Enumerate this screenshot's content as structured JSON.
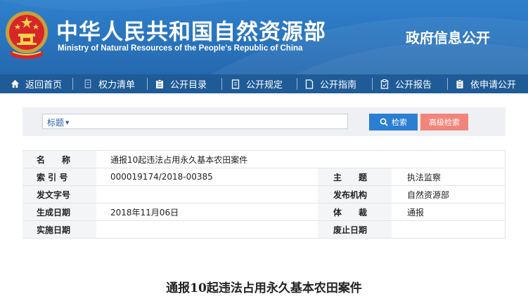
{
  "header": {
    "title_cn": "中华人民共和国自然资源部",
    "title_en": "Ministry of Natural Resources of the People's Republic of China",
    "section": "政府信息公开",
    "emblem_icon": "national-emblem-icon",
    "colors": {
      "header_blue": "#2f80cc",
      "nav_blue": "#1f5b97"
    }
  },
  "nav": {
    "items": [
      {
        "label": "返回首页",
        "icon": "home-icon"
      },
      {
        "label": "权力清单",
        "icon": "list-icon"
      },
      {
        "label": "公开目录",
        "icon": "clipboard-icon"
      },
      {
        "label": "公开规定",
        "icon": "document-icon"
      },
      {
        "label": "公开指南",
        "icon": "page-icon"
      },
      {
        "label": "公开报告",
        "icon": "report-icon"
      },
      {
        "label": "依申请公开",
        "icon": "request-icon"
      }
    ]
  },
  "search": {
    "type_label": "标题",
    "value": "",
    "search_label": "检索",
    "advanced_label": "高级检索",
    "colors": {
      "search_button": "#2b7ed1",
      "advanced_button": "#f2857b"
    }
  },
  "meta": {
    "name_label": "名　　称",
    "name_value": "通报10起违法占用永久基本农田案件",
    "index_label": "索 引 号",
    "index_value": "000019174/2018-00385",
    "topic_label": "主　　题",
    "topic_value": "执法监察",
    "docno_label": "发文字号",
    "docno_value": "",
    "publisher_label": "发布机构",
    "publisher_value": "自然资源部",
    "date_label": "生成日期",
    "date_value": "2018年11月06日",
    "genre_label": "体　　裁",
    "genre_value": "通报",
    "effective_label": "实施日期",
    "effective_value": "",
    "expiry_label": "废止日期",
    "expiry_value": ""
  },
  "document": {
    "title": "通报10起违法占用永久基本农田案件"
  }
}
